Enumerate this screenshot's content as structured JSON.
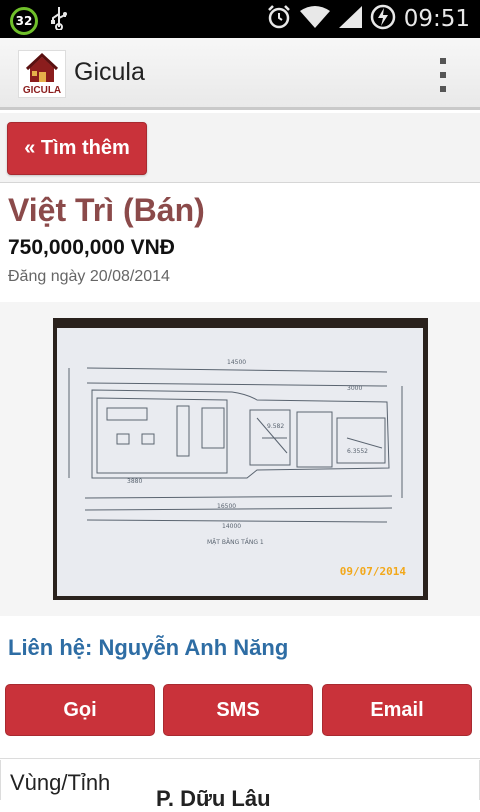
{
  "status_bar": {
    "notification_count": "32",
    "time": "09:51",
    "icons": [
      "usb-icon",
      "alarm-icon",
      "wifi-icon",
      "signal-icon",
      "battery-charging-icon"
    ]
  },
  "app": {
    "logo_text": "GICULA",
    "title": "Gicula"
  },
  "nav": {
    "back_label": "« Tìm thêm"
  },
  "listing": {
    "title": "Việt Trì (Bán)",
    "price": "750,000,000 VNĐ",
    "posted": "Đăng ngày 20/08/2014",
    "photo_stamp": "09/07/2014"
  },
  "contact": {
    "line": "Liên hệ: Nguyễn Anh Năng"
  },
  "actions": {
    "call": "Gọi",
    "sms": "SMS",
    "email": "Email"
  },
  "details": {
    "region_label": "Vùng/Tỉnh",
    "region_value": "P. Dữu Lâu"
  },
  "colors": {
    "accent": "#c9323a",
    "title": "#8b4a4a",
    "link": "#2e6da4"
  }
}
